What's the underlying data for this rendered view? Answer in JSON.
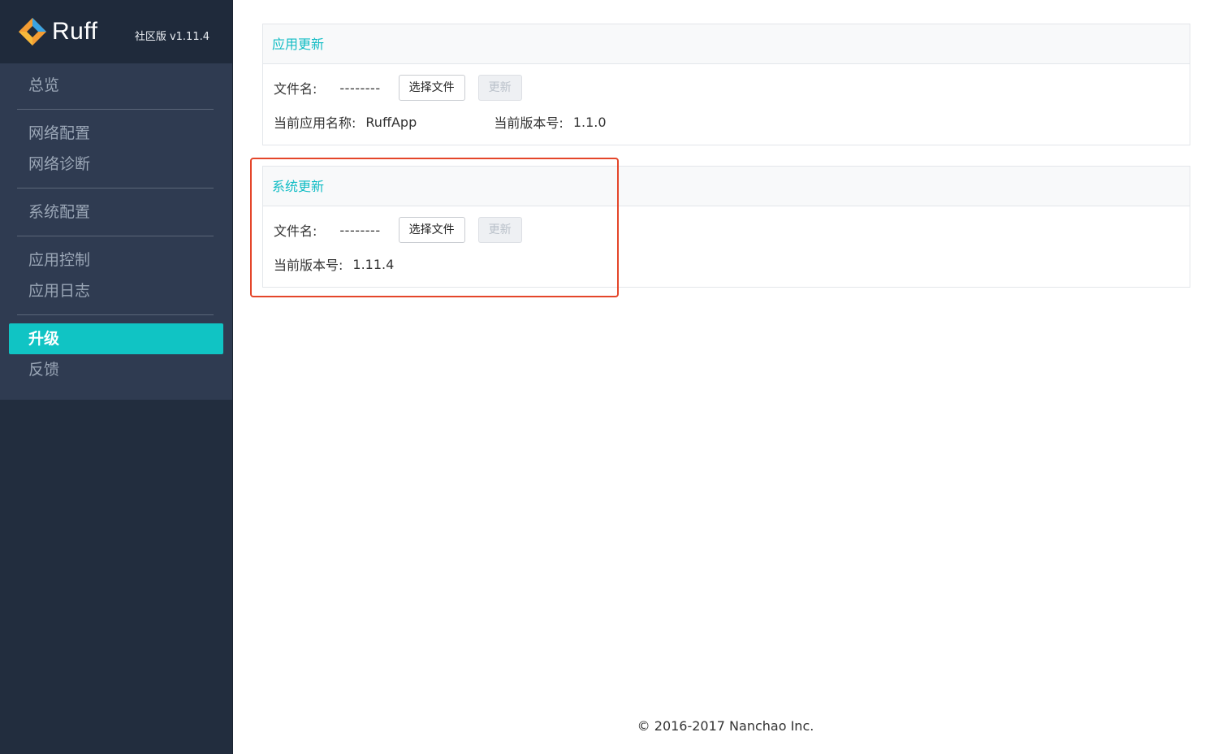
{
  "brand": {
    "name": "Ruff",
    "edition": "社区版 v1.11.4"
  },
  "sidebar": {
    "groups": [
      [
        "总览"
      ],
      [
        "网络配置",
        "网络诊断"
      ],
      [
        "系统配置"
      ],
      [
        "应用控制",
        "应用日志"
      ],
      [
        "升级",
        "反馈"
      ]
    ],
    "active": "升级"
  },
  "app_update": {
    "title": "应用更新",
    "file_label": "文件名:",
    "file_value": "--------",
    "select_button": "选择文件",
    "update_button": "更新",
    "app_name_label": "当前应用名称:",
    "app_name_value": "RuffApp",
    "version_label": "当前版本号:",
    "version_value": "1.1.0"
  },
  "system_update": {
    "title": "系统更新",
    "file_label": "文件名:",
    "file_value": "--------",
    "select_button": "选择文件",
    "update_button": "更新",
    "version_label": "当前版本号:",
    "version_value": "1.11.4"
  },
  "footer": {
    "copyright": "© 2016-2017 Nanchao Inc."
  },
  "colors": {
    "accent": "#10c4c4",
    "sidebar": "#222d3e",
    "menu": "#2f3b51",
    "highlight": "#e4462a"
  }
}
